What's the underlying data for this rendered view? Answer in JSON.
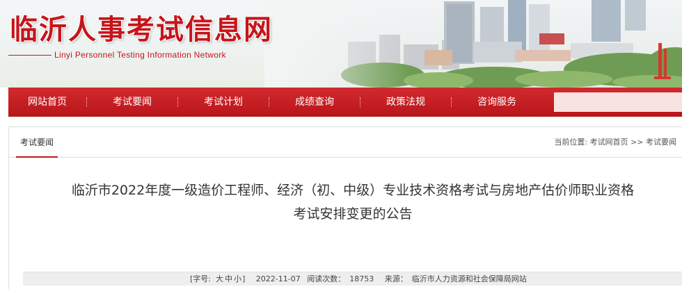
{
  "header": {
    "title": "临沂人事考试信息网",
    "subtitle": "Linyi Personnel Testing Information Network"
  },
  "nav": {
    "items": [
      {
        "label": "网站首页"
      },
      {
        "label": "考试要闻"
      },
      {
        "label": "考试计划"
      },
      {
        "label": "成绩查询"
      },
      {
        "label": "政策法规"
      },
      {
        "label": "咨询服务"
      }
    ]
  },
  "section": {
    "tab": "考试要闻",
    "breadcrumb": {
      "prefix": "当前位置:",
      "home": "考试网首页",
      "sep": ">>",
      "current": "考试要闻"
    }
  },
  "article": {
    "title_line1": "临沂市2022年度一级造价工程师、经济（初、中级）专业技术资格考试与房地产估价师职业资格",
    "title_line2": "考试安排变更的公告",
    "meta": {
      "font_label": "[字号:",
      "font_large": "大",
      "font_medium": "中",
      "font_small": "小",
      "font_end": "]",
      "date": "2022-11-07",
      "views_label": "阅读次数：",
      "views": "18753",
      "source_label": "来源：",
      "source": "临沂市人力资源和社会保障局网站"
    }
  },
  "colors": {
    "brand_red": "#c6151b",
    "nav_red": "#c41d22"
  }
}
